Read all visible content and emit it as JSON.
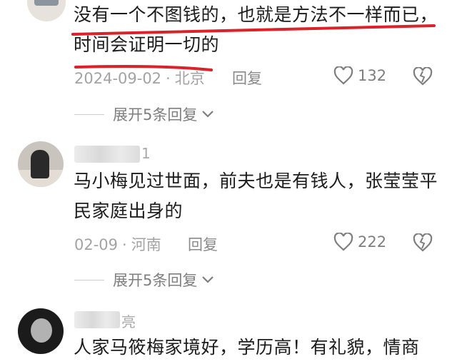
{
  "comments": [
    {
      "text": "没有一个不图钱的，也就是方法不一样而已，时间会证明一切的",
      "date": "2024-09-02",
      "location": "北京",
      "reply_label": "回复",
      "likes": "132",
      "expand_label": "展开5条回复"
    },
    {
      "username_suffix": "1",
      "text": "马小梅见过世面，前夫也是有钱人，张莹莹平民家庭出身的",
      "date": "02-09",
      "location": "河南",
      "reply_label": "回复",
      "likes": "222",
      "expand_label": "展开5条回复"
    },
    {
      "username_suffix": "亮",
      "text": "人家马筱梅家境好，学历高！有礼貌，情商"
    }
  ],
  "colors": {
    "annotation_red": "#d9222a",
    "meta_gray": "#a3a3a3",
    "text": "#1c1c1c"
  },
  "icons": [
    "heart-outline-icon",
    "broken-heart-icon",
    "chevron-down-icon"
  ]
}
